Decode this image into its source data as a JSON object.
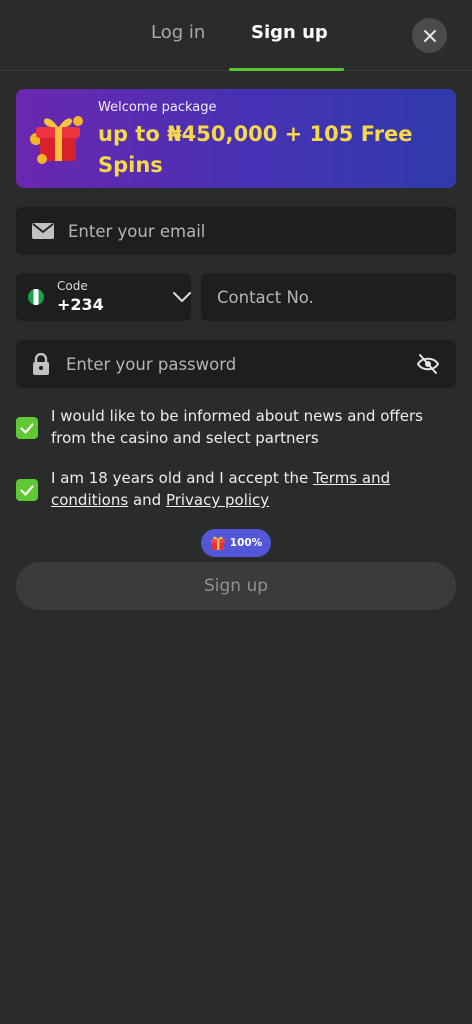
{
  "tabs": {
    "login": "Log in",
    "signup": "Sign up"
  },
  "banner": {
    "subtitle": "Welcome package",
    "title": "up to ₦450,000 + 105 Free Spins"
  },
  "form": {
    "email_placeholder": "Enter your email",
    "code_label": "Code",
    "code_value": "+234",
    "contact_placeholder": "Contact No.",
    "password_placeholder": "Enter your password"
  },
  "consents": {
    "news": "I would like to be informed about news and offers from the casino and select partners",
    "age_prefix": "I am 18 years old and I accept the ",
    "terms_link": "Terms and conditions",
    "age_mid": " and ",
    "privacy_link": "Privacy policy"
  },
  "bonus_badge": "100%",
  "submit_label": "Sign up",
  "colors": {
    "accent": "#57c52f",
    "background": "#2a2c2b",
    "field": "#1d1f1e",
    "banner_text": "#f6d94a",
    "badge": "#5456d9"
  },
  "icons": {
    "close": "close-icon",
    "email": "envelope-icon",
    "flag": "nigeria-flag-icon",
    "chevron": "chevron-down-icon",
    "lock": "lock-icon",
    "eye": "eye-off-icon",
    "check": "check-icon",
    "gift": "gift-icon"
  }
}
